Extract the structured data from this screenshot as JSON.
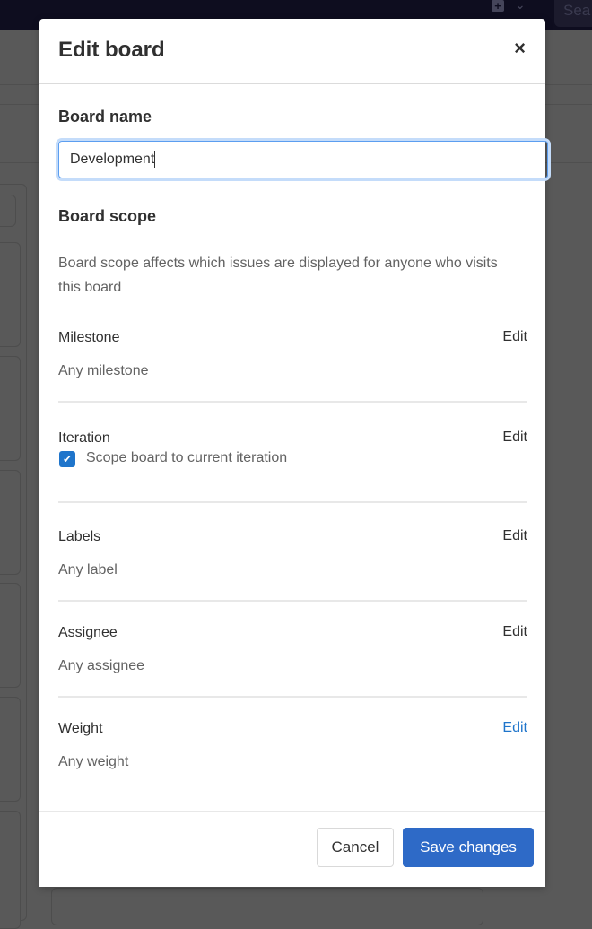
{
  "topbar": {
    "search_placeholder": "Sea"
  },
  "modal": {
    "title": "Edit board",
    "close_label": "×",
    "board_name": {
      "label": "Board name",
      "value": "Development"
    },
    "board_scope": {
      "title": "Board scope",
      "description": "Board scope affects which issues are displayed for anyone who visits this board"
    },
    "fields": [
      {
        "label": "Milestone",
        "edit": "Edit",
        "value": "Any milestone"
      },
      {
        "label": "Iteration",
        "edit": "Edit",
        "checkbox_label": "Scope board to current iteration",
        "checked": true
      },
      {
        "label": "Labels",
        "edit": "Edit",
        "value": "Any label"
      },
      {
        "label": "Assignee",
        "edit": "Edit",
        "value": "Any assignee"
      },
      {
        "label": "Weight",
        "edit": "Edit",
        "value": "Any weight"
      }
    ],
    "footer": {
      "cancel_label": "Cancel",
      "save_label": "Save changes"
    }
  },
  "colors": {
    "primary": "#2e6ac7",
    "link": "#1f75cb",
    "overlay": "#595959",
    "topbar": "#0e0d1f"
  }
}
